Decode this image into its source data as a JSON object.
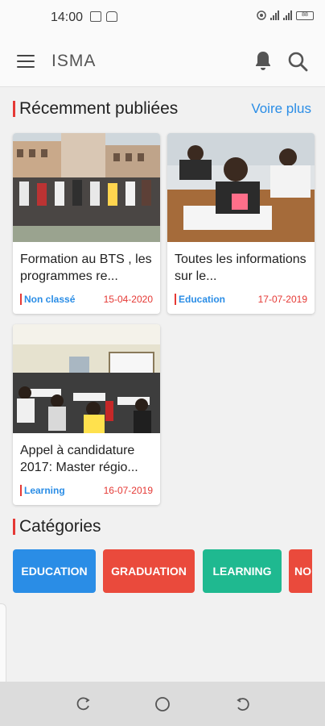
{
  "status_bar": {
    "time": "14:00",
    "battery": "88"
  },
  "app_bar": {
    "title": "ISMA"
  },
  "recent": {
    "title": "Récemment publiées",
    "see_more": "Voire plus",
    "posts": [
      {
        "title": "Formation au BTS , les programmes re...",
        "category": "Non classé",
        "date": "15-04-2020"
      },
      {
        "title": "Toutes les informations sur le...",
        "category": "Education",
        "date": "17-07-2019"
      },
      {
        "title": "Appel à candidature 2017: Master régio...",
        "category": "Learning",
        "date": "16-07-2019"
      }
    ]
  },
  "categories": {
    "title": "Catégories",
    "items": [
      {
        "label": "EDUCATION",
        "color": "#2a8de6"
      },
      {
        "label": "GRADUATION",
        "color": "#ea4a3c"
      },
      {
        "label": "LEARNING",
        "color": "#1fb990"
      },
      {
        "label": "NO",
        "color": "#ea4a3c"
      }
    ]
  },
  "colors": {
    "accent": "#e53935",
    "link": "#2a8de6"
  }
}
